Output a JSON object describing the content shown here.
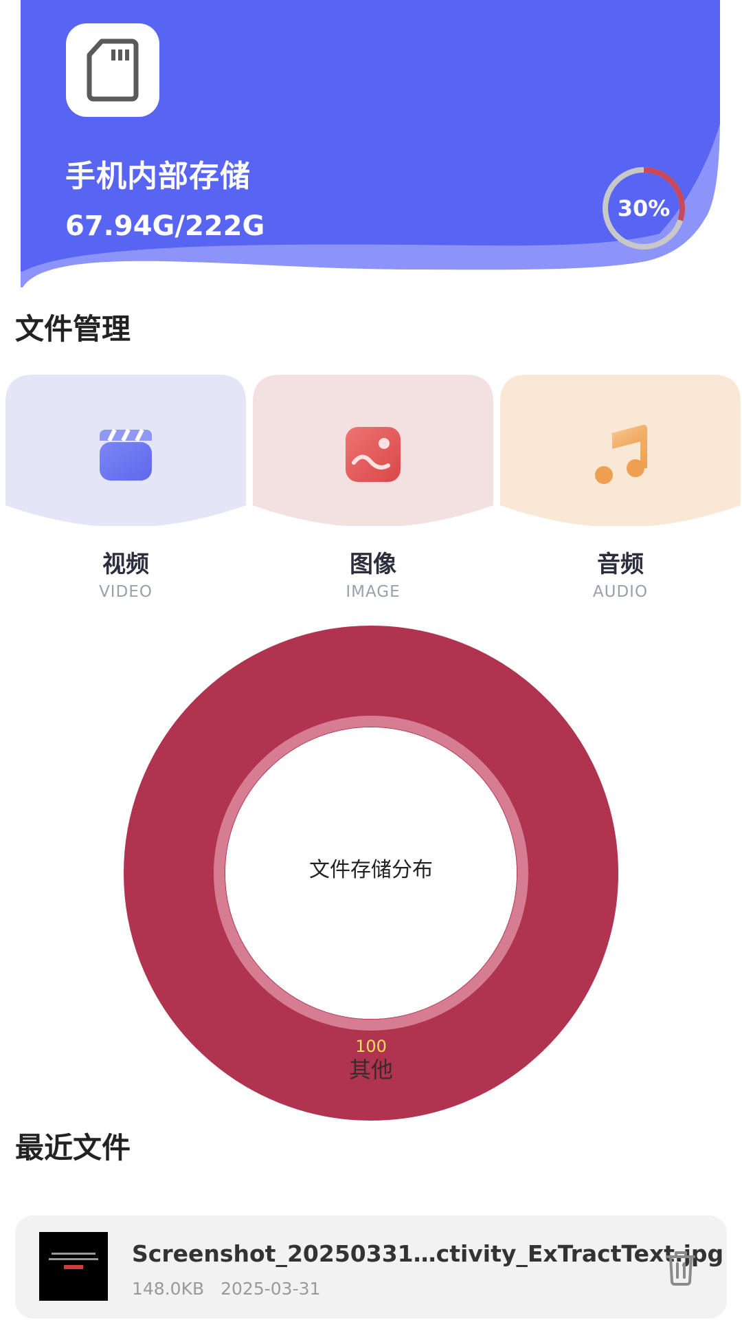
{
  "storage": {
    "title": "手机内部存储",
    "usage": "67.94G/222G",
    "used_percent": 30,
    "percent_label": "30%",
    "icon": "sd-card-icon",
    "colors": {
      "card": "#5865f2",
      "wave": "#8c94fa",
      "ring_used": "#c9485b",
      "ring_track": "#c8c8c8"
    }
  },
  "file_management": {
    "title": "文件管理",
    "categories": [
      {
        "title": "视频",
        "subtitle": "VIDEO",
        "icon": "video-icon",
        "bg": "#e4e6f8"
      },
      {
        "title": "图像",
        "subtitle": "IMAGE",
        "icon": "image-icon",
        "bg": "#f3e1e2"
      },
      {
        "title": "音频",
        "subtitle": "AUDIO",
        "icon": "audio-icon",
        "bg": "#fae8d6"
      }
    ]
  },
  "chart_data": {
    "type": "pie",
    "title": "文件存储分布",
    "series": [
      {
        "name": "其他",
        "value": 100,
        "value_label": "100",
        "color": "#b03350"
      }
    ]
  },
  "recent_files": {
    "title": "最近文件",
    "items": [
      {
        "name": "Screenshot_20250331…ctivity_ExTractText.jpg",
        "size": "148.0KB",
        "date": "2025-03-31",
        "action_icon": "trash-icon"
      }
    ]
  }
}
